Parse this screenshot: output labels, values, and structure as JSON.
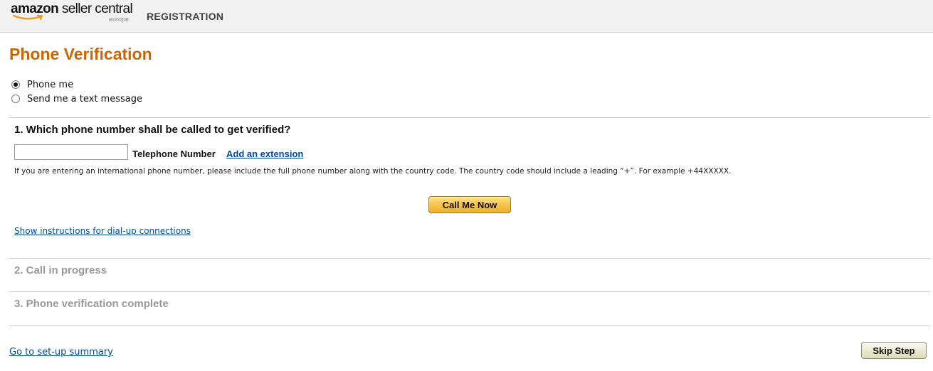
{
  "header": {
    "logo_main": "amazon seller central",
    "logo_word": "amazon",
    "logo_rest": " seller central",
    "logo_sub": "europe",
    "section": "REGISTRATION"
  },
  "page": {
    "title": "Phone Verification"
  },
  "method": {
    "options": [
      {
        "label": "Phone me",
        "checked": true
      },
      {
        "label": "Send me a text message",
        "checked": false
      }
    ]
  },
  "step1": {
    "heading": "1. Which phone number shall be called to get verified?",
    "phone_value": "",
    "phone_label": "Telephone Number",
    "extension_link": "Add an extension",
    "help": "If you are entering an international phone number, please include the full phone number along with the country code. The country code should include a leading “+”. For example +44XXXXX.",
    "call_button": "Call Me Now",
    "dialup_link": "Show instructions for dial-up connections"
  },
  "step2": {
    "heading": "2. Call in progress"
  },
  "step3": {
    "heading": "3. Phone verification complete"
  },
  "footer": {
    "summary_link": "Go to set-up summary",
    "skip_button": "Skip Step"
  },
  "colors": {
    "title": "#cc6600",
    "link": "#004b91",
    "button_gold": "#f7c44a",
    "inactive_step": "#999999"
  }
}
